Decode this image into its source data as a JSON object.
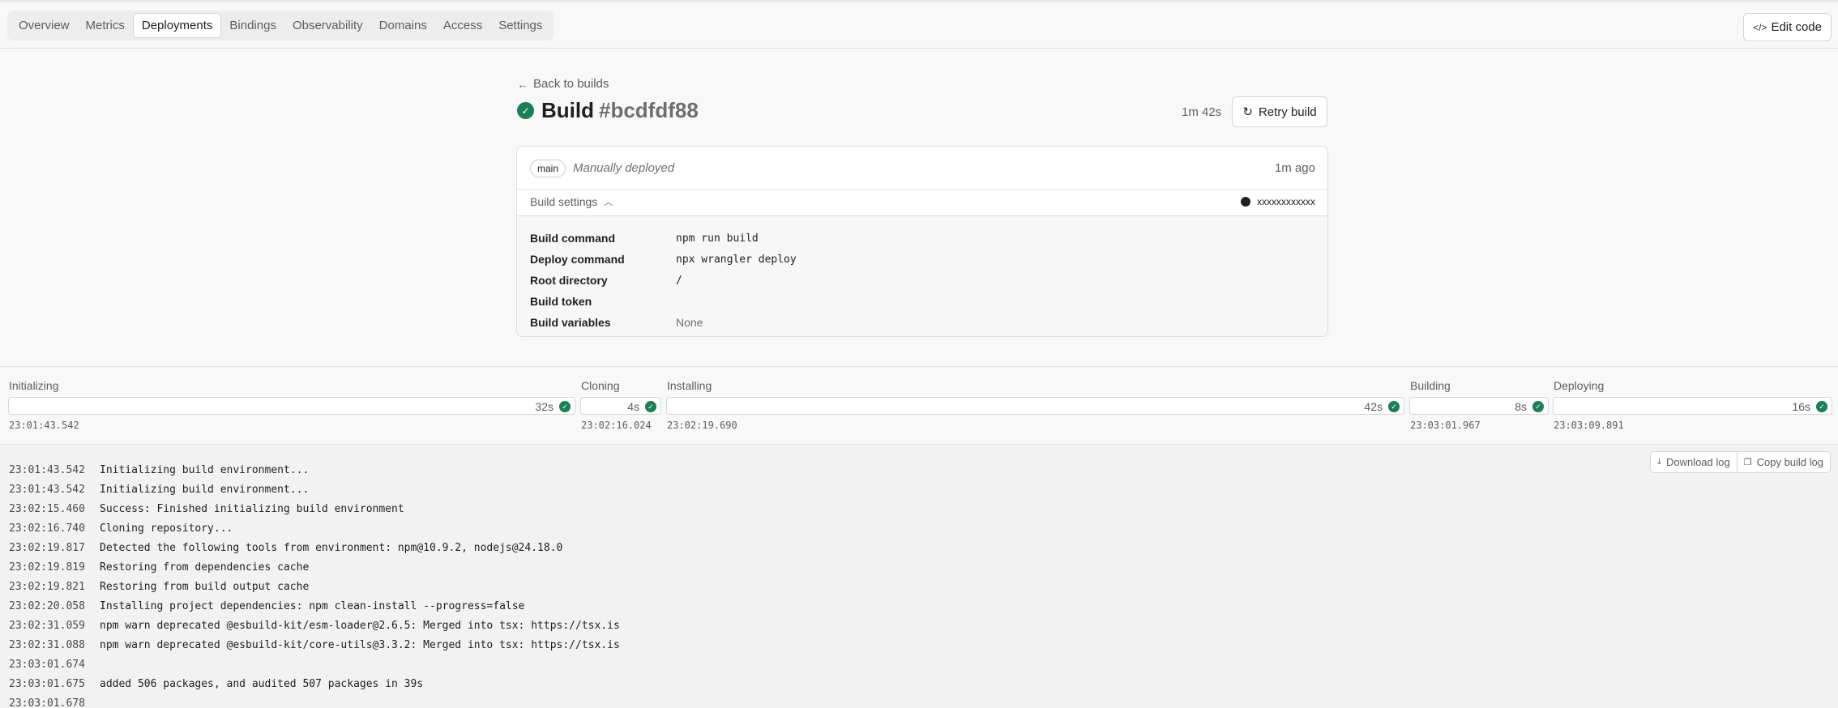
{
  "nav": {
    "tabs": [
      {
        "label": "Overview"
      },
      {
        "label": "Metrics"
      },
      {
        "label": "Deployments",
        "active": true
      },
      {
        "label": "Bindings"
      },
      {
        "label": "Observability"
      },
      {
        "label": "Domains"
      },
      {
        "label": "Access"
      },
      {
        "label": "Settings"
      }
    ],
    "edit_code": "Edit code"
  },
  "header": {
    "back": "Back to builds",
    "title": "Build",
    "build_id": "#bcdfdf88",
    "duration": "1m 42s",
    "retry": "Retry build"
  },
  "card": {
    "branch": "main",
    "deploy_type": "Manually deployed",
    "time_ago": "1m ago",
    "settings_toggle": "Build settings",
    "repo": "xxxxxxxxxxxx",
    "settings": [
      {
        "key": "Build command",
        "value": "npm run build"
      },
      {
        "key": "Deploy command",
        "value": "npx wrangler deploy"
      },
      {
        "key": "Root directory",
        "value": "/"
      },
      {
        "key": "Build token",
        "value": ""
      },
      {
        "key": "Build variables",
        "value": "None"
      }
    ]
  },
  "stages": [
    {
      "name": "Initializing",
      "duration": "32s",
      "timestamp": "23:01:43.542"
    },
    {
      "name": "Cloning",
      "duration": "4s",
      "timestamp": "23:02:16.024"
    },
    {
      "name": "Installing",
      "duration": "42s",
      "timestamp": "23:02:19.690"
    },
    {
      "name": "Building",
      "duration": "8s",
      "timestamp": "23:03:01.967"
    },
    {
      "name": "Deploying",
      "duration": "16s",
      "timestamp": "23:03:09.891"
    }
  ],
  "log": {
    "download": "Download log",
    "copy": "Copy build log",
    "lines": [
      {
        "time": "23:01:43.542",
        "text": "Initializing build environment..."
      },
      {
        "time": "23:01:43.542",
        "text": "Initializing build environment..."
      },
      {
        "time": "23:02:15.460",
        "text": "Success: Finished initializing build environment"
      },
      {
        "time": "23:02:16.740",
        "text": "Cloning repository..."
      },
      {
        "time": "23:02:19.817",
        "text": "Detected the following tools from environment: npm@10.9.2, nodejs@24.18.0"
      },
      {
        "time": "23:02:19.819",
        "text": "Restoring from dependencies cache"
      },
      {
        "time": "23:02:19.821",
        "text": "Restoring from build output cache"
      },
      {
        "time": "23:02:20.058",
        "text": "Installing project dependencies: npm clean-install --progress=false"
      },
      {
        "time": "23:02:31.059",
        "text": "npm warn deprecated @esbuild-kit/esm-loader@2.6.5: Merged into tsx: https://tsx.is"
      },
      {
        "time": "23:02:31.088",
        "text": "npm warn deprecated @esbuild-kit/core-utils@3.3.2: Merged into tsx: https://tsx.is"
      },
      {
        "time": "23:03:01.674",
        "text": ""
      },
      {
        "time": "23:03:01.675",
        "text": "added 506 packages, and audited 507 packages in 39s"
      },
      {
        "time": "23:03:01.678",
        "text": ""
      }
    ]
  }
}
